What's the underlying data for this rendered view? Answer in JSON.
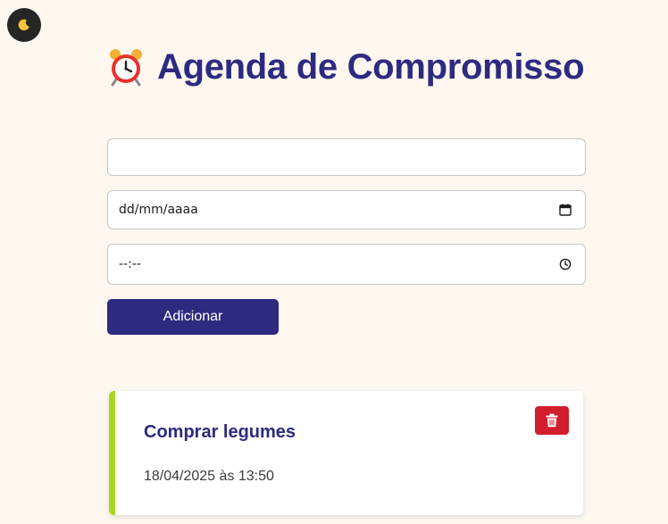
{
  "theme_toggle": {
    "icon": "moon-icon"
  },
  "header": {
    "icon": "alarm-clock-icon",
    "title": "Agenda de Compromisso"
  },
  "form": {
    "title_input": {
      "value": "",
      "placeholder": ""
    },
    "date_input": {
      "value": "dd/mm/aaaa",
      "icon": "calendar-icon"
    },
    "time_input": {
      "value": "--:--",
      "icon": "clock-icon"
    },
    "add_label": "Adicionar"
  },
  "appointments": [
    {
      "title": "Comprar legumes",
      "datetime": "18/04/2025 às 13:50",
      "delete_icon": "trash-icon"
    }
  ],
  "colors": {
    "background": "#fdf7f0",
    "primary": "#2e2a80",
    "accent": "#a6d61f",
    "danger": "#d21d2c"
  }
}
